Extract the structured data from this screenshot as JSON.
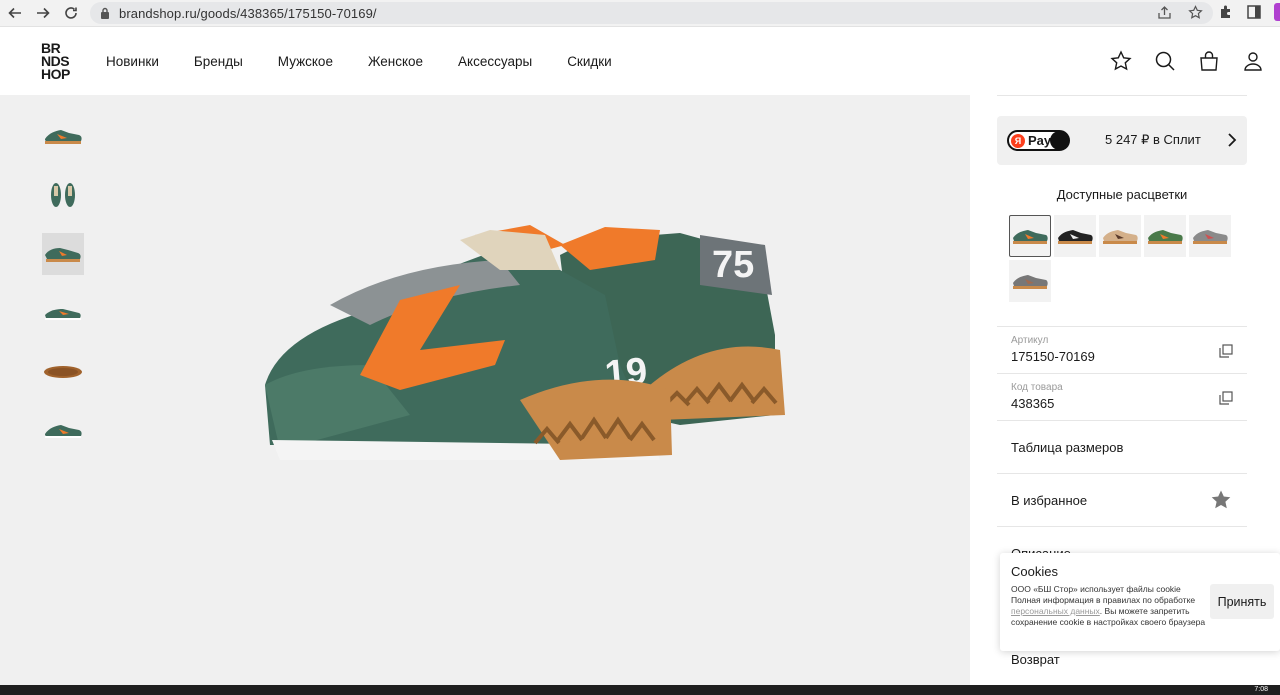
{
  "browser": {
    "url": "brandshop.ru/goods/438365/175150-70169/"
  },
  "header": {
    "logo_lines": [
      "BR",
      "NDS",
      "HOP"
    ],
    "nav": [
      "Новинки",
      "Бренды",
      "Мужское",
      "Женское",
      "Аксессуары",
      "Скидки"
    ]
  },
  "split": {
    "logo_text": "Pay",
    "ya_letter": "Я",
    "text": "5 247 ₽ в Сплит"
  },
  "colors": {
    "title": "Доступные расцветки",
    "swatches": [
      "#3f6b5c",
      "#222222",
      "#c8a070",
      "#4a7a4a",
      "#8a8a8a",
      "#777777"
    ]
  },
  "product": {
    "article_label": "Артикул",
    "article_value": "175150-70169",
    "code_label": "Код товара",
    "code_value": "438365",
    "size_table": "Таблица размеров",
    "favorites": "В избранное",
    "description": "Описание",
    "return": "Возврат"
  },
  "cookie": {
    "title": "Cookies",
    "text_before": "ООО «БШ Стор» использует файлы cookie Полная информация в правилах по обработке ",
    "link": "персональных данных",
    "text_after": ". Вы можете запретить сохранение cookie в настройках своего браузера",
    "accept": "Принять"
  },
  "taskbar": {
    "clock": "7:08"
  },
  "colors_theme": {
    "shoe_green": "#3f6b5c",
    "shoe_orange": "#f07a2a",
    "gum": "#c98a4a"
  }
}
